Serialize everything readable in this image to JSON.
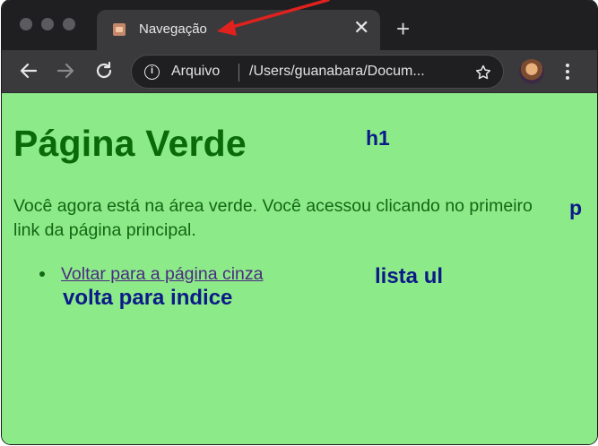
{
  "browser": {
    "tab": {
      "title": "Navegação",
      "close": "✕"
    },
    "new_tab": "+",
    "address_bar": {
      "label": "Arquivo",
      "url": "/Users/guanabara/Docum..."
    }
  },
  "page": {
    "heading": "Página Verde",
    "paragraph": "Você agora está na área verde. Você acessou clicando no primeiro link da página principal.",
    "list": [
      {
        "link_text": "Voltar para a página cinza"
      }
    ]
  },
  "annotations": {
    "h1": "h1",
    "p": "p",
    "ul": "lista ul",
    "link": "volta para indice"
  },
  "colors": {
    "page_background": "#8ceb88",
    "heading": "#0a6a0a",
    "link": "#4c2a82",
    "annotation": "#0c1a88",
    "arrow": "#e0211e"
  }
}
